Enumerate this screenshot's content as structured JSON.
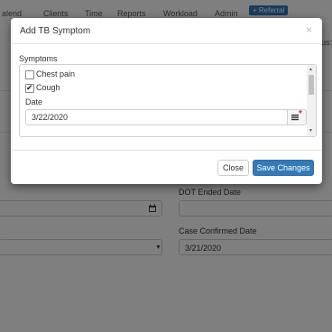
{
  "background": {
    "nav": {
      "items": [
        "alend",
        "Clients",
        "Time",
        "Reports",
        "Workload",
        "Admin"
      ],
      "referral_button": "+ Referral"
    },
    "status_label": "us:",
    "dot_ended_label": "DOT Ended Date",
    "dot_ended_value": "",
    "case_confirmed_label": "Case Confirmed Date",
    "case_confirmed_value": "3/21/2020"
  },
  "modal": {
    "title": "Add TB Symptom",
    "close_glyph": "×",
    "symptoms_label": "Symptoms",
    "symptoms": [
      {
        "label": "Chest pain",
        "checked": false
      },
      {
        "label": "Cough",
        "checked": true
      }
    ],
    "date_label": "Date",
    "date_value": "3/22/2020",
    "required_marker": "*",
    "close_button": "Close",
    "save_button": "Save Changes"
  },
  "icons": {
    "calendar": "calendar-icon",
    "scroll_up": "▲",
    "scroll_down": "▼",
    "select_caret": "▼",
    "check": "✔"
  },
  "colors": {
    "primary": "#337ab7",
    "required": "#c9302c",
    "backdrop": "rgba(0,0,0,0.5)"
  }
}
